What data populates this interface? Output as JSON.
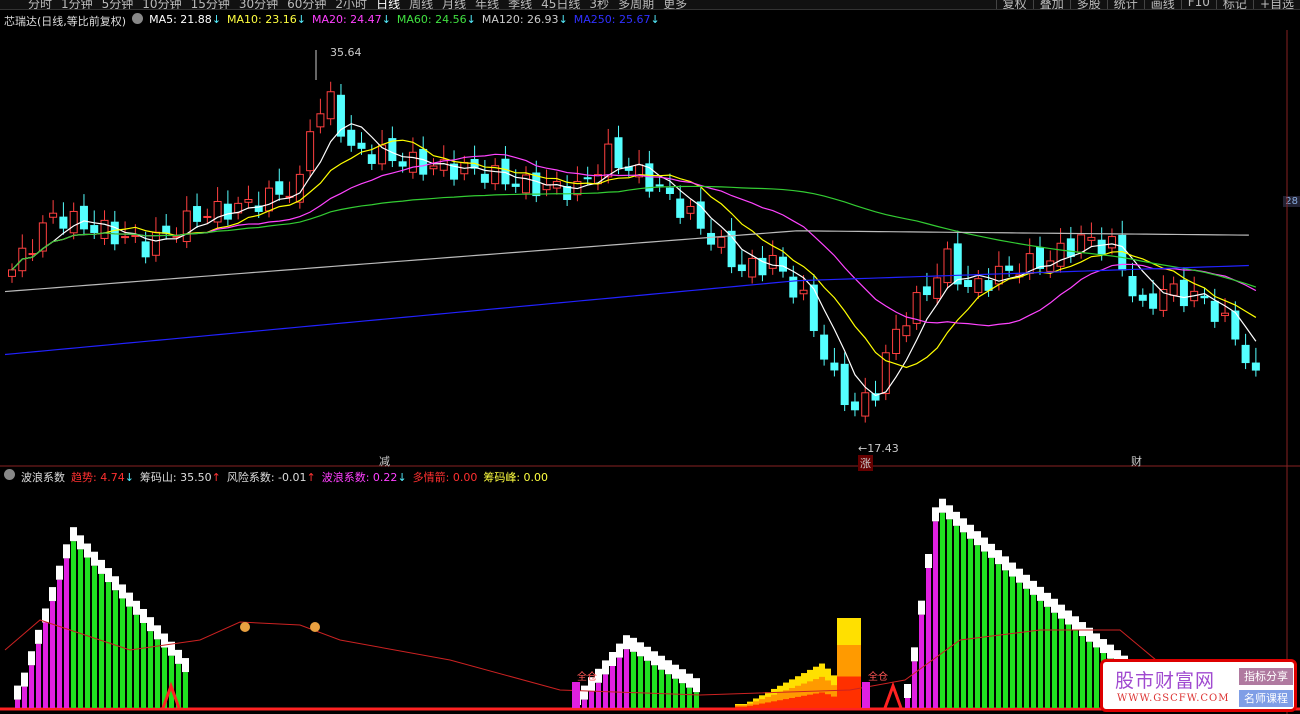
{
  "toolbar": {
    "tabs": [
      "分时",
      "1分钟",
      "5分钟",
      "10分钟",
      "15分钟",
      "30分钟",
      "60分钟",
      "2小时",
      "日线",
      "周线",
      "月线",
      "年线",
      "季线",
      "45日线",
      "3秒",
      "多周期",
      "更多"
    ],
    "active": "日线",
    "right": [
      "复权",
      "叠加",
      "多股",
      "统计",
      "画线",
      "F10",
      "标记",
      "+自选"
    ]
  },
  "main": {
    "title": "芯瑞达(日线,等比前复权)",
    "ma": [
      {
        "label": "MA5: 21.88",
        "color": "#ffffff"
      },
      {
        "label": "MA10: 23.16",
        "color": "#ffff40"
      },
      {
        "label": "MA20: 24.47",
        "color": "#ff40ff"
      },
      {
        "label": "MA60: 24.56",
        "color": "#40e040"
      },
      {
        "label": "MA120: 26.93",
        "color": "#cccccc"
      },
      {
        "label": "MA250: 25.67",
        "color": "#3030ff"
      }
    ],
    "high_label": "35.64",
    "low_label": "17.43",
    "price_tag": "28",
    "signals": [
      {
        "text": "减",
        "color": "#30e030"
      },
      {
        "text": "涨",
        "color": "#ff6060"
      },
      {
        "text": "财",
        "color": "#6fa0ff"
      }
    ]
  },
  "indicator": {
    "name": "波浪系数",
    "values": [
      {
        "label": "趋势: 4.74",
        "color": "#ff3030",
        "arrow": "down"
      },
      {
        "label": "筹码山: 35.50",
        "color": "#dddddd",
        "arrow": "up"
      },
      {
        "label": "风险系数: -0.01",
        "color": "#dddddd",
        "arrow": "up"
      },
      {
        "label": "波浪系数: 0.22",
        "color": "#ff40ff",
        "arrow": "down"
      },
      {
        "label": "多情箭: 0.00",
        "color": "#ff3030",
        "arrow": ""
      },
      {
        "label": "筹码峰: 0.00",
        "color": "#ffff40",
        "arrow": ""
      }
    ],
    "marks": [
      "全仓",
      "全仓"
    ]
  },
  "chart_data": {
    "type": "candlestick",
    "key_closes": [
      [
        0,
        25.6
      ],
      [
        4,
        28.1
      ],
      [
        9,
        27.4
      ],
      [
        13,
        26.7
      ],
      [
        18,
        28.1
      ],
      [
        23,
        28.6
      ],
      [
        28,
        29.5
      ],
      [
        29,
        32.3
      ],
      [
        31,
        33.4
      ],
      [
        33,
        31.1
      ],
      [
        36,
        30.9
      ],
      [
        40,
        30.4
      ],
      [
        45,
        30.2
      ],
      [
        50,
        29.5
      ],
      [
        55,
        29.3
      ],
      [
        58,
        30.9
      ],
      [
        62,
        29.7
      ],
      [
        66,
        28.1
      ],
      [
        71,
        25.6
      ],
      [
        74,
        26.0
      ],
      [
        77,
        24.2
      ],
      [
        80,
        20.5
      ],
      [
        82,
        19.1
      ],
      [
        84,
        20.1
      ],
      [
        86,
        22.8
      ],
      [
        89,
        24.7
      ],
      [
        91,
        26.1
      ],
      [
        93,
        24.7
      ],
      [
        97,
        25.6
      ],
      [
        101,
        26.1
      ],
      [
        104,
        27.0
      ],
      [
        107,
        26.7
      ],
      [
        110,
        23.7
      ],
      [
        112,
        24.7
      ],
      [
        116,
        24.2
      ],
      [
        119,
        22.6
      ],
      [
        121,
        20.5
      ]
    ],
    "ma120": [
      [
        0,
        24.6
      ],
      [
        77,
        27.4
      ],
      [
        121,
        27.2
      ]
    ],
    "ma250": [
      [
        0,
        21.7
      ],
      [
        77,
        25.1
      ],
      [
        121,
        25.8
      ]
    ],
    "high": 35.64,
    "low": 17.43
  }
}
